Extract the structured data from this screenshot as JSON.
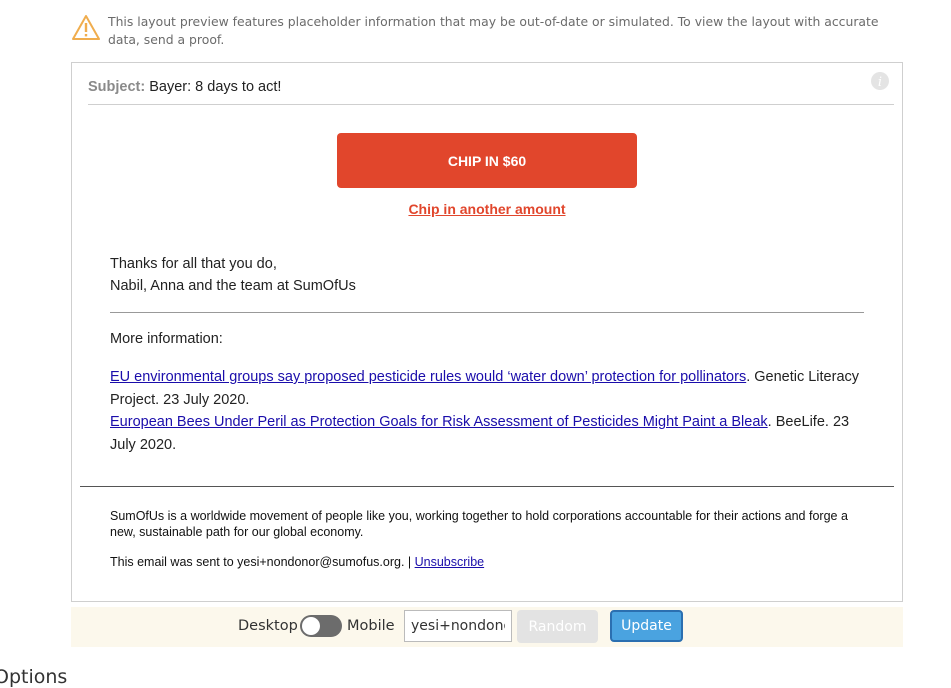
{
  "notice": {
    "text": "This layout preview features placeholder information that may be out-of-date or simulated. To view the layout with accurate data, send a proof.",
    "icon": "warning-icon",
    "color": "#f0ad4e"
  },
  "email": {
    "subject_label": "Subject:",
    "subject": "Bayer: 8 days to act!",
    "cta_button": "CHIP IN $60",
    "cta_link": "Chip in another amount",
    "thanks_line1": "Thanks for all that you do,",
    "thanks_line2": "Nabil, Anna and the team at SumOfUs",
    "more_info": "More information:",
    "refs": [
      {
        "link": "EU environmental groups say proposed pesticide rules would ‘water down’ protection for pollinators",
        "source": ". Genetic Literacy Project. 23 July 2020."
      },
      {
        "link": "European Bees Under Peril as Protection Goals for Risk Assessment of Pesticides Might Paint a Bleak",
        "source": ". BeeLife. 23 July 2020."
      }
    ],
    "footer_about": "SumOfUs is a worldwide movement of people like you, working together to hold corporations accountable for their actions and forge a new, sustainable path for our global economy.",
    "footer_sent": "This email was sent to yesi+nondonor@sumofus.org. | ",
    "unsubscribe": "Unsubscribe",
    "accent": "#e1462c"
  },
  "toolbar": {
    "desktop_label": "Desktop",
    "mobile_label": "Mobile",
    "email_value": "yesi+nondonor@sumofus.org",
    "random_label": "Random",
    "update_label": "Update"
  },
  "section_heading": "Options"
}
